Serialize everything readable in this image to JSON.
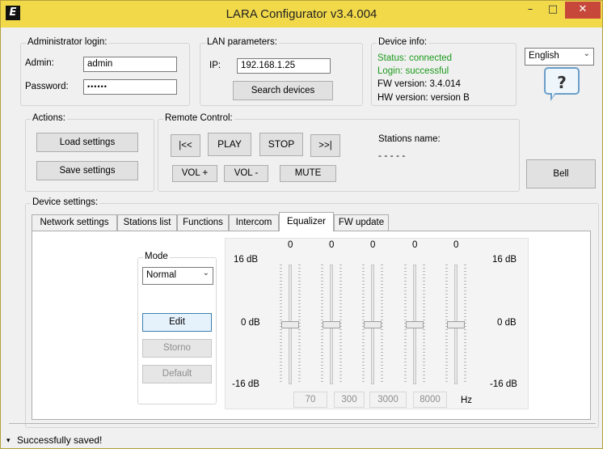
{
  "window": {
    "title": "LARA Configurator v3.4.004",
    "logo_letter": "E",
    "minimize_glyph": "–",
    "maximize_glyph": "□",
    "close_glyph": "✕",
    "accent_color": "#f2d94a",
    "close_color": "#c7473b"
  },
  "admin_login": {
    "group_label": "Administrator login:",
    "admin_label": "Admin:",
    "admin_value": "admin",
    "password_label": "Password:",
    "password_value": "••••••"
  },
  "lan": {
    "group_label": "LAN parameters:",
    "ip_label": "IP:",
    "ip_value": "192.168.1.25",
    "search_button": "Search devices"
  },
  "device_info": {
    "group_label": "Device info:",
    "status": "Status: connected",
    "login": "Login: successful",
    "fw_version": "FW version: 3.4.014",
    "hw_version": "HW version: version B",
    "status_color": "#1b9a1b"
  },
  "language": {
    "selected": "English",
    "help_glyph": "?"
  },
  "actions": {
    "group_label": "Actions:",
    "load_button": "Load settings",
    "save_button": "Save settings"
  },
  "remote_control": {
    "group_label": "Remote Control:",
    "prev_button": "|<<",
    "play_button": "PLAY",
    "stop_button": "STOP",
    "next_button": ">>|",
    "vol_up_button": "VOL +",
    "vol_down_button": "VOL -",
    "mute_button": "MUTE",
    "stations_label": "Stations name:",
    "stations_value": "- - - - -"
  },
  "bell_button": "Bell",
  "device_settings": {
    "group_label": "Device settings:",
    "tabs": [
      {
        "label": "Network settings"
      },
      {
        "label": "Stations list"
      },
      {
        "label": "Functions"
      },
      {
        "label": "Intercom"
      },
      {
        "label": "Equalizer",
        "active": true
      },
      {
        "label": "FW update"
      }
    ]
  },
  "equalizer": {
    "mode_group_label": "Mode",
    "mode_selected": "Normal",
    "edit_button": "Edit",
    "storno_button": "Storno",
    "default_button": "Default",
    "top_label_left": "16 dB",
    "mid_label_left": "0 dB",
    "bottom_label_left": "-16 dB",
    "top_label_right": "16 dB",
    "mid_label_right": "0 dB",
    "bottom_label_right": "-16 dB",
    "hz_label": "Hz",
    "bands": [
      {
        "value": "0",
        "freq": "70",
        "level_db": 0
      },
      {
        "value": "0",
        "freq": "300",
        "level_db": 0
      },
      {
        "value": "0",
        "freq": "3000",
        "level_db": 0
      },
      {
        "value": "0",
        "freq": "8000",
        "level_db": 0
      },
      {
        "value": "0",
        "level_db": 0
      }
    ]
  },
  "status_bar": {
    "message": "Successfully saved!",
    "expander_glyph": "▾"
  }
}
